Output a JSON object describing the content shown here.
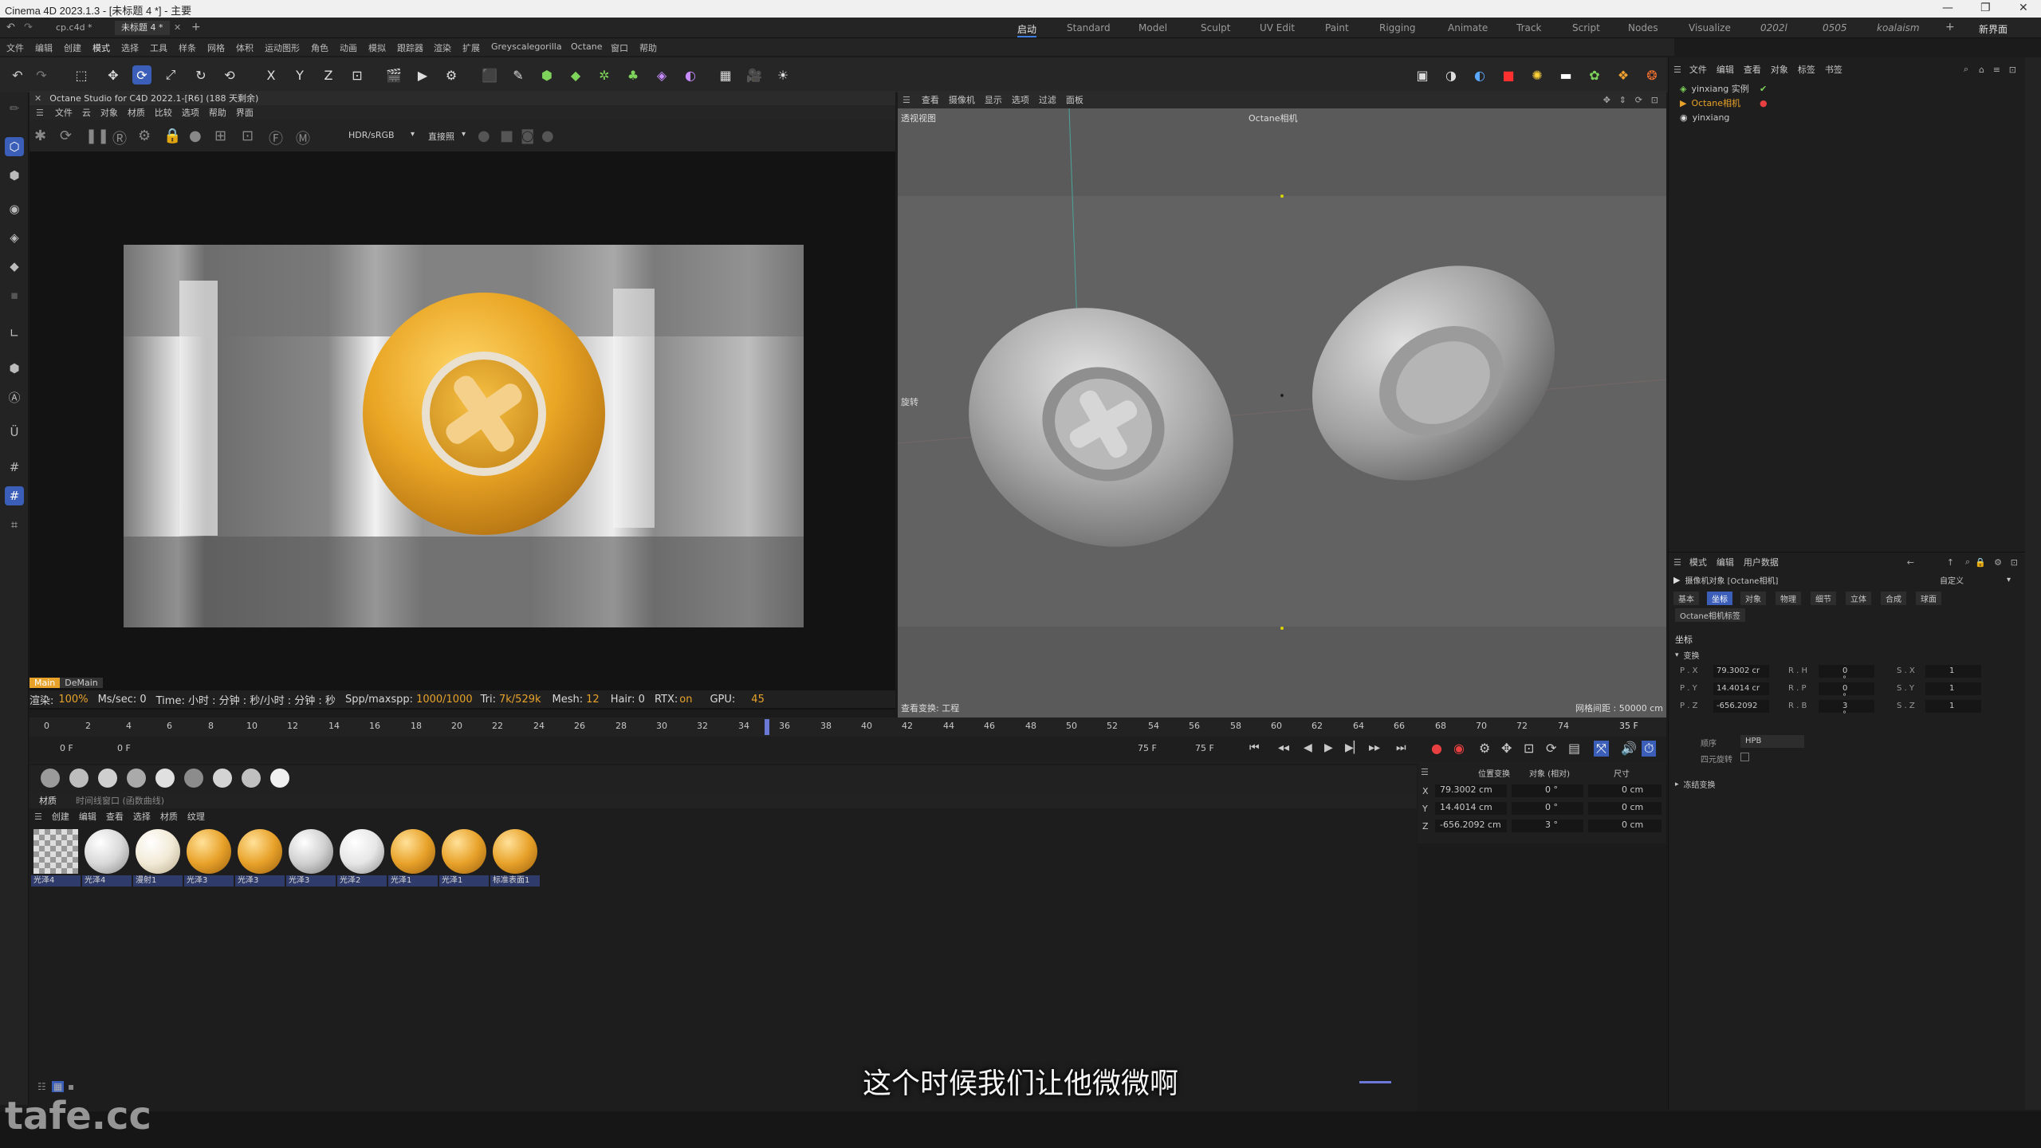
{
  "window": {
    "title": "Cinema 4D 2023.1.3 - [未标题 4 *] - 主要",
    "controls": [
      "—",
      "❐",
      "✕"
    ]
  },
  "doc_tabs": [
    {
      "label": "cp.c4d *",
      "active": false
    },
    {
      "label": "未标题 4 *",
      "active": true
    }
  ],
  "layout_tabs": [
    {
      "label": "启动",
      "active": true
    },
    {
      "label": "Standard"
    },
    {
      "label": "Model"
    },
    {
      "label": "Sculpt"
    },
    {
      "label": "UV Edit"
    },
    {
      "label": "Paint"
    },
    {
      "label": "Rigging"
    },
    {
      "label": "Animate"
    },
    {
      "label": "Track"
    },
    {
      "label": "Script"
    },
    {
      "label": "Nodes"
    },
    {
      "label": "Visualize"
    },
    {
      "label": "0202l"
    },
    {
      "label": "0505"
    },
    {
      "label": "koalaism"
    }
  ],
  "new_layout_label": "新界面",
  "menus": [
    "文件",
    "编辑",
    "创建",
    "模式",
    "选择",
    "工具",
    "样条",
    "网格",
    "体积",
    "运动图形",
    "角色",
    "动画",
    "模拟",
    "跟踪器",
    "渲染",
    "扩展",
    "Greyscalegorilla",
    "Octane",
    "窗口",
    "帮助"
  ],
  "octane": {
    "title": "Octane Studio for C4D 2022.1-[R6] (188 天剩余)",
    "menu": [
      "文件",
      "云",
      "对象",
      "材质",
      "比较",
      "选项",
      "帮助",
      "界面"
    ],
    "color_mode": "HDR/sRGB",
    "view_mode": "直接照",
    "tags": [
      "Main",
      "DeMain"
    ],
    "status": {
      "render_label": "渲染:",
      "render_pct": "100%",
      "ms": "Ms/sec: 0",
      "time": "Time: 小时 : 分钟 : 秒/小时 : 分钟 : 秒",
      "spp_label": "Spp/maxspp:",
      "spp": "1000/1000",
      "tri_label": "Tri:",
      "tri": "7k/529k",
      "mesh_label": "Mesh:",
      "mesh": "12",
      "hair": "Hair: 0",
      "rtx_label": "RTX:",
      "rtx": "on",
      "gpu_label": "GPU:",
      "gpu": "45"
    }
  },
  "viewport": {
    "menu": [
      "查看",
      "摄像机",
      "显示",
      "选项",
      "过滤",
      "面板"
    ],
    "label": "透视视图",
    "camera": "Octane相机",
    "mode_label": "旋转",
    "bottom_left": "查看变换: 工程",
    "grid_info": "网格间距 : 50000 cm"
  },
  "timeline": {
    "ticks": [
      "0",
      "2",
      "4",
      "6",
      "8",
      "10",
      "12",
      "14",
      "16",
      "18",
      "20",
      "22",
      "24",
      "26",
      "28",
      "30",
      "32",
      "34",
      "36",
      "38",
      "40",
      "42",
      "44",
      "46",
      "48",
      "50",
      "52",
      "54",
      "56",
      "58",
      "60",
      "62",
      "64",
      "66",
      "68",
      "70",
      "72",
      "74"
    ],
    "current_frame": "35 F",
    "start": "0 F",
    "start2": "0 F",
    "end": "75 F",
    "end2": "75 F"
  },
  "materials": {
    "tabs": [
      "材质",
      "时间线窗口 (函数曲线)"
    ],
    "menu": [
      "创建",
      "编辑",
      "查看",
      "选择",
      "材质",
      "纹理"
    ],
    "items": [
      {
        "label": "光泽4",
        "color": "checker"
      },
      {
        "label": "光泽4",
        "color": "#d9d9d9"
      },
      {
        "label": "漫射1",
        "color": "#f2ead6"
      },
      {
        "label": "光泽3",
        "color": "#e8a22a"
      },
      {
        "label": "光泽3",
        "color": "#e8a22a"
      },
      {
        "label": "光泽3",
        "color": "#cfcfcf"
      },
      {
        "label": "光泽2",
        "color": "#e6e6e6"
      },
      {
        "label": "光泽1",
        "color": "#e8a22a"
      },
      {
        "label": "光泽1",
        "color": "#e8a22a"
      },
      {
        "label": "标准表面1",
        "color": "#e8a22a"
      }
    ]
  },
  "coords": {
    "headers": [
      "位置变换",
      "对象 (相对)",
      "尺寸"
    ],
    "rows": [
      {
        "axis": "X",
        "pos": "79.3002 cm",
        "rot": "0 °",
        "size": "0 cm"
      },
      {
        "axis": "Y",
        "pos": "14.4014 cm",
        "rot": "0 °",
        "size": "0 cm"
      },
      {
        "axis": "Z",
        "pos": "-656.2092 cm",
        "rot": "3 °",
        "size": "0 cm"
      }
    ]
  },
  "objects": {
    "menu": [
      "文件",
      "编辑",
      "查看",
      "对象",
      "标签",
      "书签"
    ],
    "items": [
      {
        "name": "yinxiang 实例",
        "highlight": false
      },
      {
        "name": "Octane相机",
        "highlight": true
      },
      {
        "name": "yinxiang",
        "highlight": false
      }
    ]
  },
  "attributes": {
    "menu": [
      "模式",
      "编辑",
      "用户数据"
    ],
    "object_title": "摄像机对象 [Octane相机]",
    "preset": "自定义",
    "tabs": [
      "基本",
      "坐标",
      "对象",
      "物理",
      "细节",
      "立体",
      "合成",
      "球面"
    ],
    "active_tab": "坐标",
    "tag_label": "Octane相机标签",
    "section": "坐标",
    "subsection": "变换",
    "fields": [
      {
        "p_label": "P . X",
        "p_val": "79.3002 cr",
        "r_label": "R . H",
        "r_val": "0 °",
        "s_label": "S . X",
        "s_val": "1"
      },
      {
        "p_label": "P . Y",
        "p_val": "14.4014 cr",
        "r_label": "R . P",
        "r_val": "0 °",
        "s_label": "S . Y",
        "s_val": "1"
      },
      {
        "p_label": "P . Z",
        "p_val": "-656.2092",
        "r_label": "R . B",
        "r_val": "3 °",
        "s_label": "S . Z",
        "s_val": "1"
      }
    ],
    "order_label": "顺序",
    "order_value": "HPB",
    "quat_label": "四元旋转",
    "freeze_label": "冻结变换"
  },
  "subtitle": "这个时候我们让他微微啊",
  "watermark": "tafe.cc"
}
